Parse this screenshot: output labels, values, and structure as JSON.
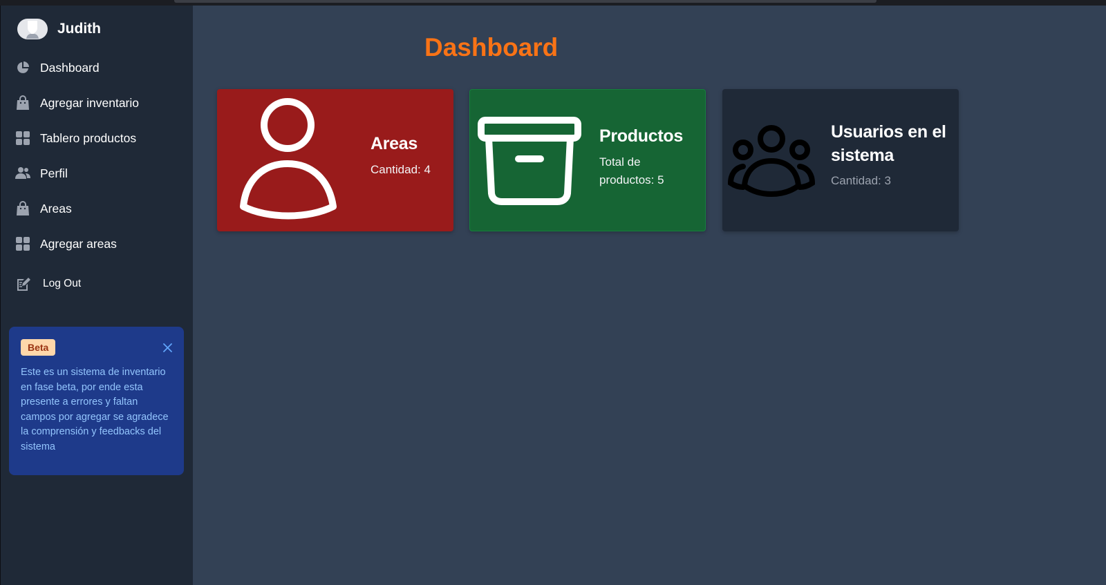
{
  "user": {
    "name": "Judith"
  },
  "nav": [
    {
      "label": "Dashboard",
      "icon": "pie-chart-icon"
    },
    {
      "label": "Agregar inventario",
      "icon": "shopping-bag-icon"
    },
    {
      "label": "Tablero productos",
      "icon": "grid-icon"
    },
    {
      "label": "Perfil",
      "icon": "users-icon"
    },
    {
      "label": "Areas",
      "icon": "shopping-bag-icon"
    },
    {
      "label": "Agregar areas",
      "icon": "grid-icon"
    },
    {
      "label": "Log Out",
      "icon": "edit-document-icon"
    }
  ],
  "beta": {
    "badge": "Beta",
    "text": "Este es un sistema de inventario en fase beta, por ende esta presente a errores y faltan campos por agregar se agradece la comprensión y feedbacks del sistema"
  },
  "page": {
    "title": "Dashboard"
  },
  "cards": [
    {
      "title": "Areas",
      "subtitle": "Cantidad: 4",
      "icon": "user-icon",
      "color": "#991b1b"
    },
    {
      "title": "Productos",
      "subtitle": "Total de productos: 5",
      "icon": "archive-box-icon",
      "color": "#166534"
    },
    {
      "title": "Usuarios en el sistema",
      "subtitle": "Cantidad: 3",
      "icon": "user-group-icon",
      "color": "#1f2937"
    }
  ],
  "colors": {
    "sidebar_bg": "#1f2937",
    "main_bg": "#334155",
    "title_orange": "#f97316",
    "beta_bg": "#1e3a8a",
    "beta_text": "#93c5fd"
  }
}
